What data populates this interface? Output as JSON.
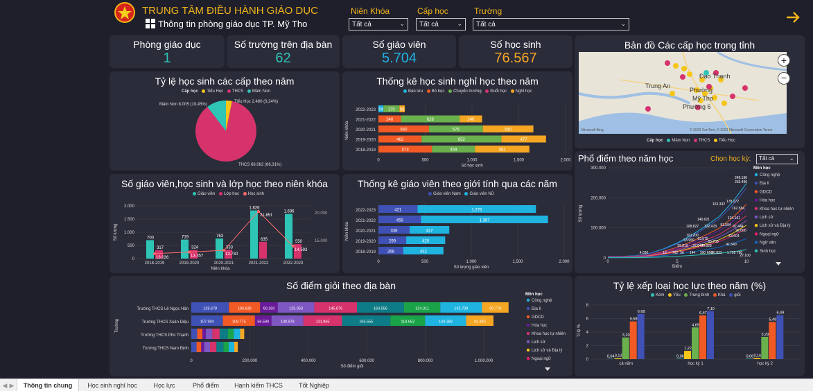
{
  "header": {
    "title": "TRUNG TÂM ĐIỀU HÀNH GIÁO DỤC",
    "subtitle": "Thông tin phòng giáo dục TP. Mỹ Tho",
    "colors": {
      "title": "#f3b519",
      "background": "#1e1f2b",
      "card": "#2b2c3a"
    }
  },
  "slicers": [
    {
      "label": "Niên Khóa",
      "value": "Tất cả"
    },
    {
      "label": "Cấp học",
      "value": "Tất cả"
    },
    {
      "label": "Trường",
      "value": "Tất cả"
    }
  ],
  "kpis": [
    {
      "label": "Phòng giáo dục",
      "value": "1",
      "color": "#2ec4b6"
    },
    {
      "label": "Số trường trên địa bàn",
      "value": "62",
      "color": "#2ec4b6"
    },
    {
      "label": "Số giáo viên",
      "value": "5.704",
      "color": "#1fb3e0"
    },
    {
      "label": "Số học sinh",
      "value": "76.567",
      "color": "#f5a623"
    }
  ],
  "map": {
    "title": "Bản đồ Các cấp học trong tỉnh",
    "places": [
      "Đạo Thạnh",
      "Trung An",
      "Phường",
      "Mỹ Tho",
      "Phường 6"
    ],
    "attribution": "© 2023 TomTom, © 2023 Microsoft Corporation  Terms",
    "brand": "Microsoft Bing",
    "legend_title": "Cấp học",
    "legend": [
      {
        "name": "Mầm Non",
        "color": "#2ec4b6"
      },
      {
        "name": "THCS",
        "color": "#d6336c"
      },
      {
        "name": "Tiểu Học",
        "color": "#f5c518"
      }
    ]
  },
  "chart_data": [
    {
      "type": "pie",
      "title": "Tỷ lệ học sinh các cấp theo năm",
      "legend_title": "Cấp học",
      "labels": [
        "Tiểu Học",
        "THCS",
        "Mầm Non"
      ],
      "values": [
        2480,
        66082,
        8005
      ],
      "colors": [
        "#f5c518",
        "#d6336c",
        "#2ec4b6"
      ],
      "data_labels": [
        "Tiểu Học 2.480 (3,24%)",
        "THCS 66.082 (86,31%)",
        "Mầm Non 8.005 (10,45%)"
      ]
    },
    {
      "type": "bar",
      "title": "Thống kê học sinh nghỉ học theo năm",
      "stacked": true,
      "orientation": "horizontal",
      "ylabel": "Niên khóa",
      "xlabel": "Số học sinh",
      "categories": [
        "2022-2023",
        "2021-2022",
        "2020-2021",
        "2019-2020",
        "2018-2019"
      ],
      "xlim": [
        0,
        2000
      ],
      "xticks": [
        "0",
        "500",
        "1.000",
        "1.500",
        "2.000"
      ],
      "series": [
        {
          "name": "Bảo lưu",
          "color": "#1fb3e0",
          "values": [
            54,
            0,
            0,
            0,
            0
          ],
          "labels": [
            "54",
            "",
            "",
            "",
            ""
          ]
        },
        {
          "name": "Bỏ học",
          "color": "#f15a24",
          "values": [
            0,
            240,
            540,
            462,
            573
          ],
          "labels": [
            "",
            "240",
            "540",
            "462",
            "573"
          ]
        },
        {
          "name": "Chuyển trường",
          "color": "#6ab04c",
          "values": [
            170,
            628,
            576,
            852,
            459
          ],
          "labels": [
            "170",
            "628",
            "576",
            "852",
            "459"
          ]
        },
        {
          "name": "Đuổi học",
          "color": "#d6336c",
          "values": [
            0,
            0,
            0,
            0,
            0
          ],
          "labels": [
            "",
            "",
            "",
            "",
            ""
          ]
        },
        {
          "name": "Nghỉ học",
          "color": "#f5a623",
          "values": [
            58,
            240,
            540,
            477,
            581
          ],
          "labels": [
            "58",
            "240",
            "540",
            "477",
            "581"
          ]
        }
      ]
    },
    {
      "type": "bar",
      "title": "Số giáo viên,học sinh và lớp học theo niên khóa",
      "xlabel": "Niên khóa",
      "ylabel": "Số lượng",
      "categories": [
        "2018-2019",
        "2019-2020",
        "2020-2021",
        "2021-2022",
        "2022-2023"
      ],
      "ylim": [
        0,
        2000
      ],
      "yticks": [
        "0",
        "500",
        "1.000",
        "1.500",
        "2.000"
      ],
      "y2ticks": [
        "15.000",
        "20.000"
      ],
      "series": [
        {
          "name": "Giáo viên",
          "type": "bar",
          "color": "#2ec4b6",
          "values": [
            700,
            719,
            763,
            1826,
            1696
          ],
          "labels": [
            "700",
            "719",
            "763",
            "1.826",
            "1.696"
          ]
        },
        {
          "name": "Lớp học",
          "type": "bar",
          "color": "#d6336c",
          "values": [
            317,
            324,
            333,
            635,
            550
          ],
          "labels": [
            "317",
            "324",
            "333",
            "635",
            "550"
          ]
        },
        {
          "name": "Học sinh",
          "type": "line",
          "color": "#ff6b6b",
          "values": [
            13036,
            13357,
            13730,
            21851,
            14593
          ],
          "labels": [
            "13.036",
            "13.357",
            "13.730",
            "21.851",
            "14.593"
          ]
        }
      ]
    },
    {
      "type": "bar",
      "title": "Thống kê giáo viên theo giới tính qua các năm",
      "stacked": true,
      "orientation": "horizontal",
      "ylabel": "Niên khóa",
      "xlabel": "Số lượng giáo viên",
      "categories": [
        "2022-2023",
        "2021-2022",
        "2020-2021",
        "2019-2020",
        "2018-2019"
      ],
      "xlim": [
        0,
        2000
      ],
      "xticks": [
        "0",
        "500",
        "1.000",
        "1.500",
        "2.000"
      ],
      "series": [
        {
          "name": "Giáo viên Nam",
          "color": "#3f51b5",
          "values": [
            421,
            459,
            336,
            299,
            268
          ],
          "labels": [
            "421",
            "459",
            "336",
            "299",
            "268"
          ]
        },
        {
          "name": "Giáo viên Nữ",
          "color": "#1fb3e0",
          "values": [
            1275,
            1367,
            427,
            420,
            432
          ],
          "labels": [
            "1.275",
            "1.367",
            "427",
            "420",
            "432"
          ]
        }
      ]
    },
    {
      "type": "line",
      "title": "Phổ điểm theo năm học",
      "filter": {
        "label": "Chọn học kỳ:",
        "value": "Tất cả"
      },
      "xlabel": "Điểm",
      "ylabel": "Số lượng",
      "ylim": [
        0,
        300000
      ],
      "yticks": [
        "0",
        "100.000",
        "200.000",
        "300.000"
      ],
      "xlim": [
        0,
        10
      ],
      "xticks": [
        "0",
        "5",
        "10"
      ],
      "legend_title": "Môn học",
      "subjects": [
        {
          "name": "Công nghệ",
          "color": "#1fb3e0"
        },
        {
          "name": "Địa lí",
          "color": "#3f51b5"
        },
        {
          "name": "GDCD",
          "color": "#f15a24"
        },
        {
          "name": "Hóa học",
          "color": "#6a1b9a"
        },
        {
          "name": "Khoa học tự nhiên",
          "color": "#d6336c"
        },
        {
          "name": "Lịch sử",
          "color": "#7e57c2"
        },
        {
          "name": "Lịch sử và Địa lý",
          "color": "#f5c518"
        },
        {
          "name": "Ngoại ngữ",
          "color": "#e91e63"
        },
        {
          "name": "Ngữ văn",
          "color": "#1565c0"
        },
        {
          "name": "Sinh học",
          "color": "#2ec4b6"
        }
      ],
      "data_labels": [
        "248.190",
        "233.490",
        "178.172",
        "162.332",
        "162.584",
        "140.621",
        "124.161",
        "122.478",
        "108.827",
        "97.444",
        "91.594",
        "92.000",
        "110.200",
        "63.959",
        "63.575",
        "65.758",
        "53.604",
        "59.819",
        "22.047",
        "40.828",
        "41.540",
        "60.833",
        "1.758",
        "780",
        "4.030",
        "12",
        "762",
        "56",
        "144",
        "390",
        "650",
        "27.100"
      ]
    },
    {
      "type": "bar",
      "title": "Số điểm giỏi theo địa bàn",
      "stacked": true,
      "orientation": "horizontal",
      "ylabel": "Trường",
      "xlabel": "Số điểm giỏi",
      "categories": [
        "Trường THCS Lê Ngọc Hân",
        "Trường THCS Xuân Diệu",
        "Trường THCS Phú Thạnh",
        "Trường THCS Nam Định"
      ],
      "xlim": [
        0,
        1000000
      ],
      "xticks": [
        "0",
        "200.000",
        "400.000",
        "600.000",
        "800.000",
        "1.000.000"
      ],
      "legend_title": "Môn học",
      "segments": [
        {
          "color": "#3f51b5",
          "values": [
            128678,
            107904,
            20000,
            18000
          ],
          "labels": [
            "128.678",
            "107.904",
            "",
            ""
          ]
        },
        {
          "color": "#f15a24",
          "values": [
            106639,
            109775,
            18000,
            16000
          ],
          "labels": [
            "106.639",
            "109.775",
            "",
            ""
          ]
        },
        {
          "color": "#6a1b9a",
          "values": [
            60160,
            56590,
            12000,
            10000
          ],
          "labels": [
            "60.160",
            "56.590",
            "",
            ""
          ]
        },
        {
          "color": "#7e57c2",
          "values": [
            125053,
            108978,
            22000,
            20000
          ],
          "labels": [
            "125.053",
            "108.978",
            "",
            ""
          ]
        },
        {
          "color": "#d6336c",
          "values": [
            145876,
            131865,
            25000,
            22000
          ],
          "labels": [
            "145.876",
            "131.865",
            "",
            ""
          ]
        },
        {
          "color": "#0e7c86",
          "values": [
            160556,
            165555,
            28000,
            24000
          ],
          "labels": [
            "160.556",
            "165.555",
            "",
            ""
          ]
        },
        {
          "color": "#1ba34a",
          "values": [
            124311,
            118652,
            20000,
            18000
          ],
          "labels": [
            "124.311",
            "118.652",
            "",
            ""
          ]
        },
        {
          "color": "#1fb3e0",
          "values": [
            142738,
            140389,
            22000,
            19000
          ],
          "labels": [
            "142.738",
            "140.389",
            "",
            ""
          ]
        },
        {
          "color": "#f5a623",
          "values": [
            90778,
            93380,
            14000,
            12000
          ],
          "labels": [
            "90.778",
            "93.380",
            "",
            ""
          ]
        }
      ],
      "legend": [
        {
          "name": "Công nghệ",
          "color": "#1fb3e0"
        },
        {
          "name": "Địa lí",
          "color": "#3f51b5"
        },
        {
          "name": "GDCD",
          "color": "#f15a24"
        },
        {
          "name": "Hóa học",
          "color": "#6a1b9a"
        },
        {
          "name": "Khoa học tự nhiên",
          "color": "#d6336c"
        },
        {
          "name": "Lịch sử",
          "color": "#7e57c2"
        },
        {
          "name": "Lịch sử và Địa lý",
          "color": "#f5c518"
        },
        {
          "name": "Ngoại ngữ",
          "color": "#e91e63"
        }
      ]
    },
    {
      "type": "bar",
      "title": "Tỷ lệ xếp loại học lực theo năm (%)",
      "ylabel": "Tỉ lệ %",
      "categories": [
        "cả năm",
        "học kỳ 1",
        "học kỳ 2"
      ],
      "ylim": [
        0,
        8
      ],
      "yticks": [
        "0",
        "2",
        "4",
        "6",
        "8"
      ],
      "series": [
        {
          "name": "Kém",
          "color": "#2ec4b6",
          "values": [
            0.04,
            0.06,
            0.06
          ],
          "labels": [
            "0,04",
            "0,06",
            "0,06"
          ]
        },
        {
          "name": "Yếu",
          "color": "#f5c518",
          "values": [
            0.13,
            1.22,
            0.16
          ],
          "labels": [
            "0,13",
            "1,22",
            "0,16"
          ]
        },
        {
          "name": "Trung bình",
          "color": "#6ab04c",
          "values": [
            3.2,
            4.69,
            3.29
          ],
          "labels": [
            "3,20",
            "4,69",
            "3,29"
          ]
        },
        {
          "name": "Khá",
          "color": "#f15a24",
          "values": [
            5.58,
            6.47,
            5.49
          ],
          "labels": [
            "5,58",
            "6,47",
            "5,49"
          ]
        },
        {
          "name": "giỏi",
          "color": "#3f51b5",
          "values": [
            6.68,
            7.1,
            6.49
          ],
          "labels": [
            "6,68",
            "7,10",
            "6,49"
          ]
        }
      ]
    }
  ],
  "tabs": [
    "Thông tin chung",
    "Học sinh nghỉ học",
    "Học lực",
    "Phổ điểm",
    "Hạnh kiểm THCS",
    "Tốt Nghiệp"
  ]
}
